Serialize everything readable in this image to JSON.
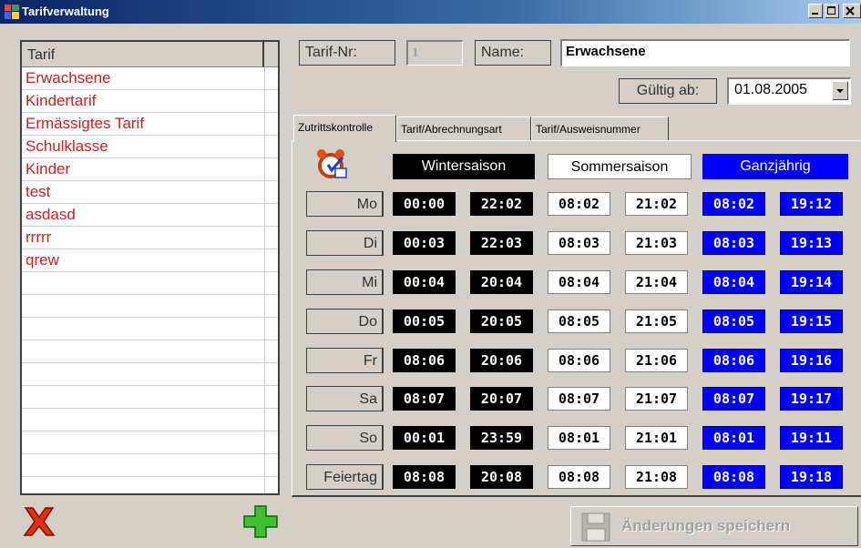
{
  "window": {
    "title": "Tarifverwaltung"
  },
  "list": {
    "header": "Tarif",
    "items": [
      "Erwachsene",
      "Kindertarif",
      "Ermässigtes Tarif",
      "Schulklasse",
      "Kinder",
      "test",
      "asdasd",
      "rrrrr",
      "qrew"
    ]
  },
  "form": {
    "tarif_nr_label": "Tarif-Nr:",
    "tarif_nr_value": "1",
    "name_label": "Name:",
    "name_value": "Erwachsene",
    "gueltig_label": "Gültig ab:",
    "gueltig_value": "01.08.2005"
  },
  "tabs": [
    "Zutrittskontrolle",
    "Tarif/Abrechnungsart",
    "Tarif/Ausweisnummer"
  ],
  "seasons": {
    "winter": "Wintersaison",
    "summer": "Sommersaison",
    "all": "Ganzjährig"
  },
  "schedule": [
    {
      "day": "Mo",
      "w": [
        "00:00",
        "22:02"
      ],
      "s": [
        "08:02",
        "21:02"
      ],
      "g": [
        "08:02",
        "19:12"
      ]
    },
    {
      "day": "Di",
      "w": [
        "00:03",
        "22:03"
      ],
      "s": [
        "08:03",
        "21:03"
      ],
      "g": [
        "08:03",
        "19:13"
      ]
    },
    {
      "day": "Mi",
      "w": [
        "00:04",
        "20:04"
      ],
      "s": [
        "08:04",
        "21:04"
      ],
      "g": [
        "08:04",
        "19:14"
      ]
    },
    {
      "day": "Do",
      "w": [
        "00:05",
        "20:05"
      ],
      "s": [
        "08:05",
        "21:05"
      ],
      "g": [
        "08:05",
        "19:15"
      ]
    },
    {
      "day": "Fr",
      "w": [
        "08:06",
        "20:06"
      ],
      "s": [
        "08:06",
        "21:06"
      ],
      "g": [
        "08:06",
        "19:16"
      ]
    },
    {
      "day": "Sa",
      "w": [
        "08:07",
        "20:07"
      ],
      "s": [
        "08:07",
        "21:07"
      ],
      "g": [
        "08:07",
        "19:17"
      ]
    },
    {
      "day": "So",
      "w": [
        "00:01",
        "23:59"
      ],
      "s": [
        "08:01",
        "21:01"
      ],
      "g": [
        "08:01",
        "19:11"
      ]
    },
    {
      "day": "Feiertag",
      "w": [
        "08:08",
        "20:08"
      ],
      "s": [
        "08:08",
        "21:08"
      ],
      "g": [
        "08:08",
        "19:18"
      ]
    }
  ],
  "buttons": {
    "save": "Änderungen speichern"
  },
  "icons": {
    "delete": "red-x-icon",
    "add": "green-plus-icon",
    "alarm": "alarm-clock-icon",
    "save": "floppy-disk-icon"
  },
  "colors": {
    "winter_bg": "#000000",
    "summer_bg": "#ffffff",
    "all_year_bg": "#0000ff",
    "list_text": "#d02020"
  }
}
